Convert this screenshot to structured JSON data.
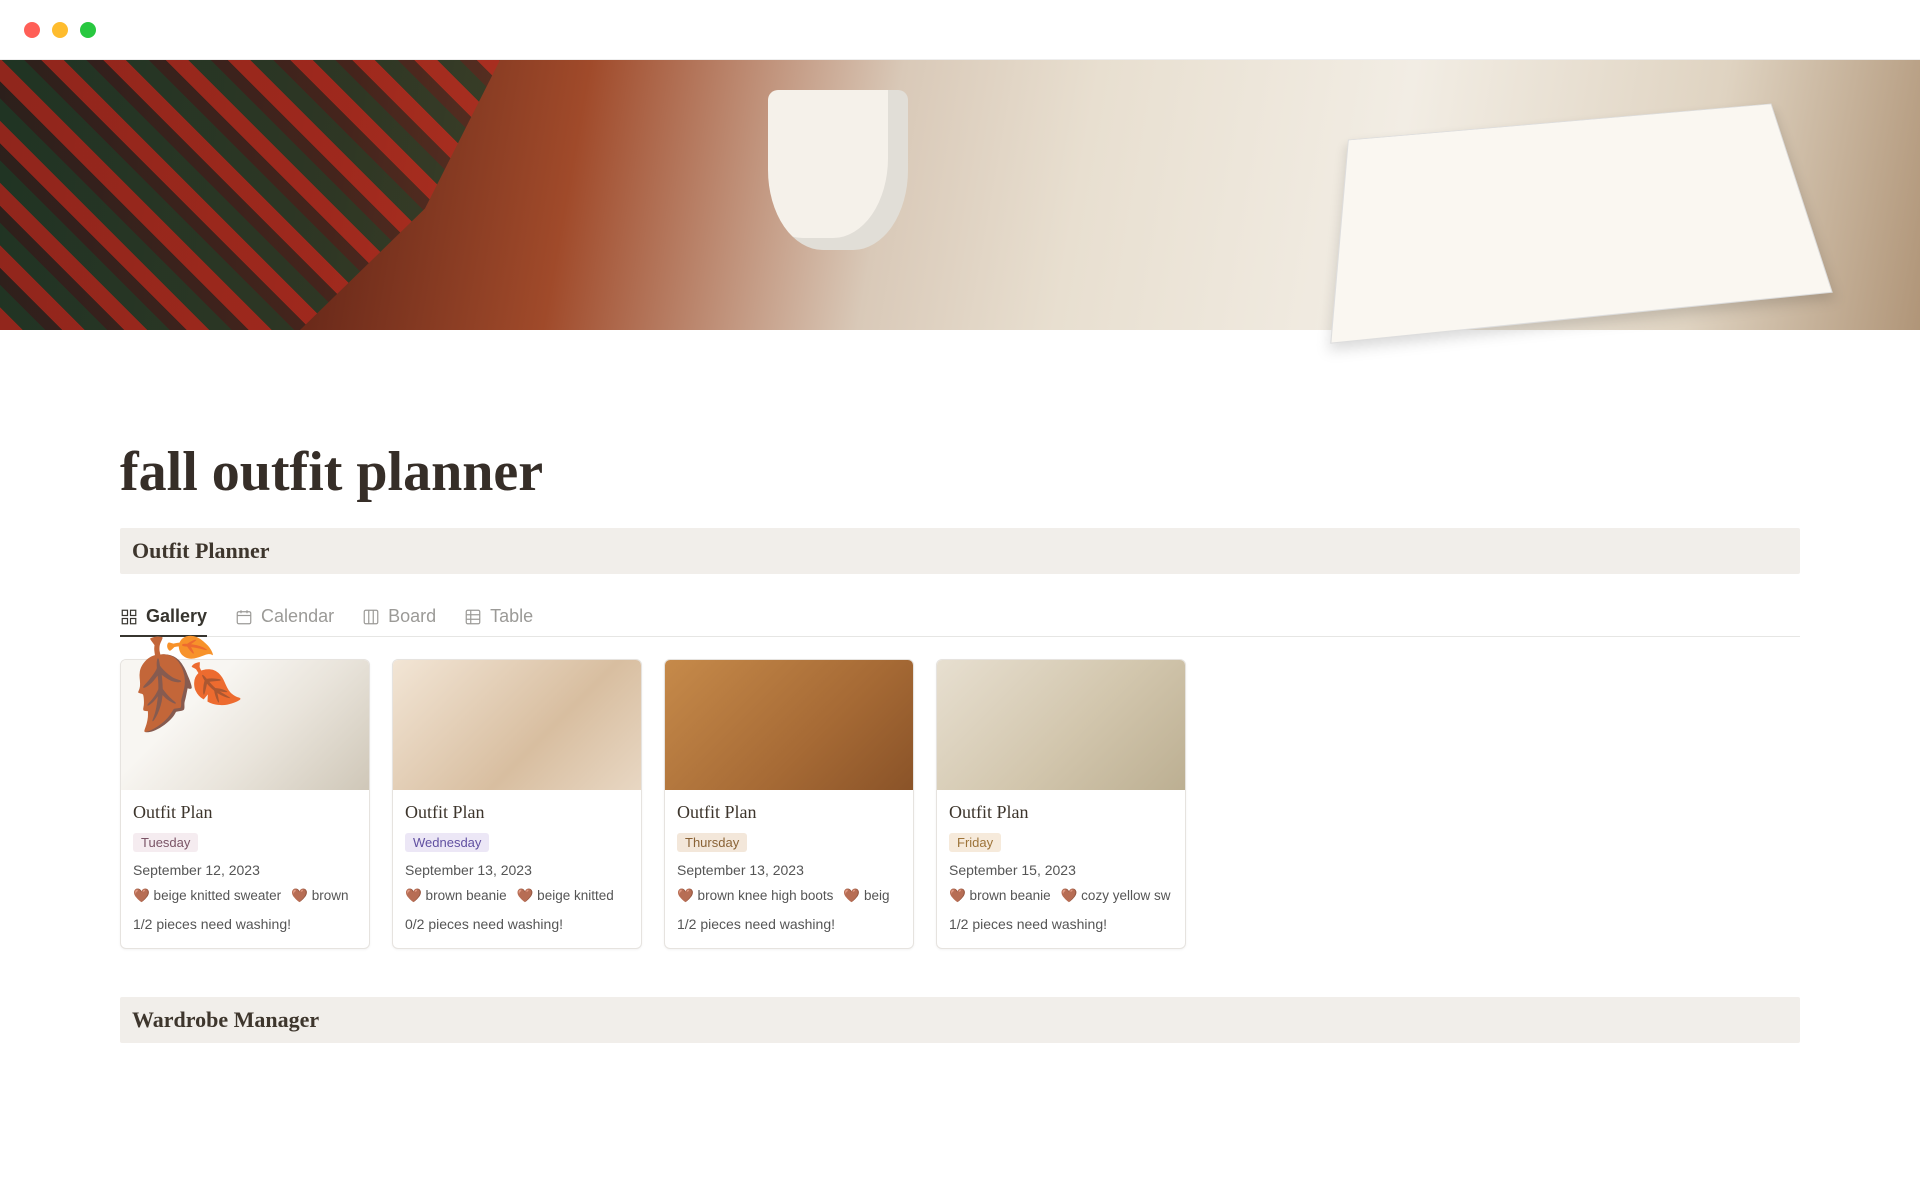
{
  "page": {
    "title": "fall outfit planner",
    "icon": "🍂"
  },
  "section_outfit_planner": "Outfit Planner",
  "section_wardrobe_manager": "Wardrobe Manager",
  "tabs": {
    "gallery": "Gallery",
    "calendar": "Calendar",
    "board": "Board",
    "table": "Table"
  },
  "cards": [
    {
      "title": "Outfit Plan",
      "day": "Tuesday",
      "day_class": "tag-tuesday",
      "date": "September 12, 2023",
      "pieces": [
        "🤎 beige knitted sweater",
        "🤎 brown"
      ],
      "wash": "1/2 pieces need washing!"
    },
    {
      "title": "Outfit Plan",
      "day": "Wednesday",
      "day_class": "tag-wednesday",
      "date": "September 13, 2023",
      "pieces": [
        "🤎 brown beanie",
        "🤎 beige knitted"
      ],
      "wash": "0/2 pieces need washing!"
    },
    {
      "title": "Outfit Plan",
      "day": "Thursday",
      "day_class": "tag-thursday",
      "date": "September 13, 2023",
      "pieces": [
        "🤎 brown knee high boots",
        "🤎 beig"
      ],
      "wash": "1/2 pieces need washing!"
    },
    {
      "title": "Outfit Plan",
      "day": "Friday",
      "day_class": "tag-friday",
      "date": "September 15, 2023",
      "pieces": [
        "🤎 brown beanie",
        "🤎 cozy yellow sw"
      ],
      "wash": "1/2 pieces need washing!"
    }
  ]
}
